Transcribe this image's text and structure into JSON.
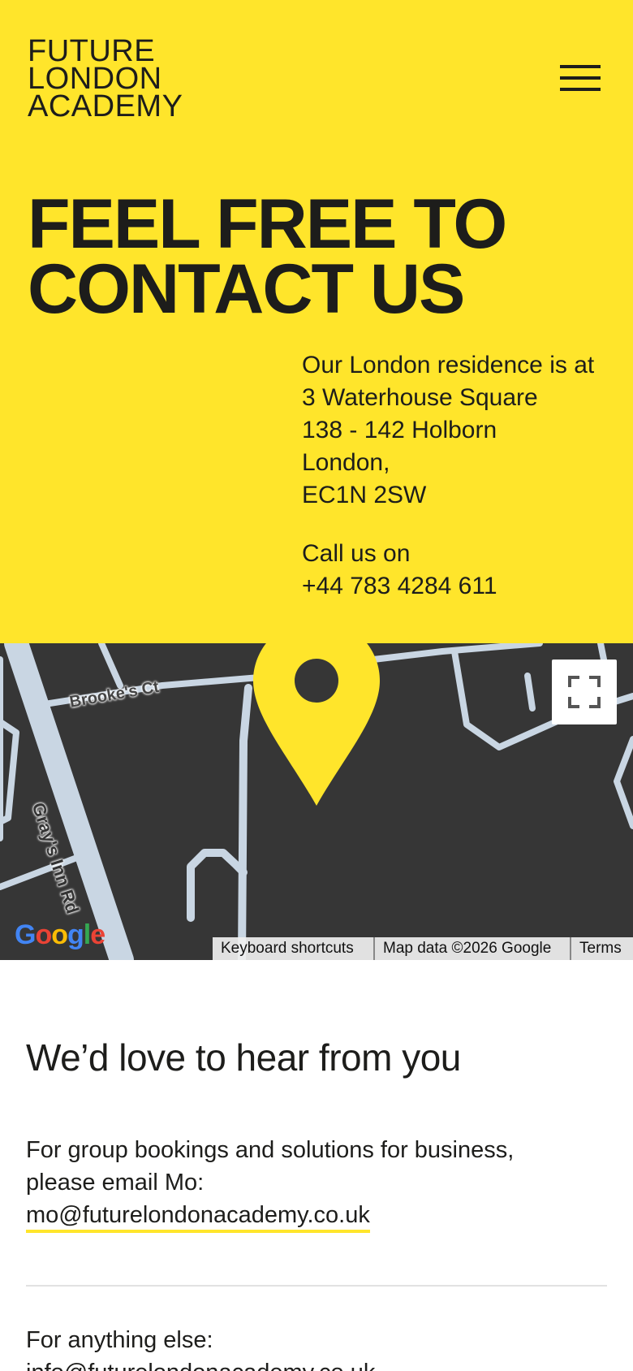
{
  "logo": {
    "lines": [
      "FUTURE",
      "LONDON",
      "ACADEMY"
    ]
  },
  "hero": {
    "headline_lines": [
      "FEEL FREE TO",
      "CONTACT US"
    ],
    "address_lines": [
      "Our London residence is at",
      "3 Waterhouse Square",
      "138 - 142 Holborn",
      "London,",
      "EC1N 2SW"
    ],
    "call_lines": [
      "Call us on",
      "+44 783 4284 611"
    ]
  },
  "map": {
    "street_labels": [
      "Brooke's Ct",
      "Gray's Inn Rd"
    ],
    "google_logo": "Google",
    "attribution": {
      "shortcuts": "Keyboard shortcuts",
      "data": "Map data ©2026 Google",
      "terms": "Terms"
    }
  },
  "contact": {
    "title": "We’d love to hear from you",
    "group_lines": [
      "For group bookings and solutions for business,",
      "please email Mo:"
    ],
    "group_email": "mo@futurelondonacademy.co.uk",
    "else_label": "For anything else:",
    "else_email": "info@futurelondonacademy.co.uk"
  },
  "colors": {
    "brand_yellow": "#ffe52b",
    "text_dark": "#1d1d1b",
    "map_bg": "#363636",
    "road": "#c9d6e3"
  },
  "icons": [
    "menu-icon",
    "fullscreen-icon",
    "location-pin-icon"
  ]
}
